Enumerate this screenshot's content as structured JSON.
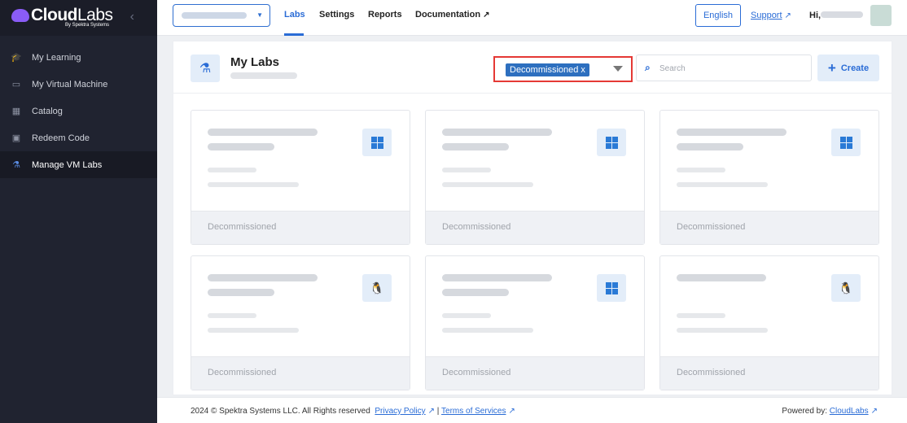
{
  "brand": {
    "name_bold": "Cloud",
    "name_light": "Labs",
    "tagline": "By Spektra Systems"
  },
  "sidebar": {
    "items": [
      {
        "label": "My Learning",
        "icon": "graduation-cap-icon",
        "active": false
      },
      {
        "label": "My Virtual Machine",
        "icon": "monitor-icon",
        "active": false
      },
      {
        "label": "Catalog",
        "icon": "grid-icon",
        "active": false
      },
      {
        "label": "Redeem Code",
        "icon": "ticket-icon",
        "active": false
      },
      {
        "label": "Manage VM Labs",
        "icon": "flask-icon",
        "active": true
      }
    ]
  },
  "topbar": {
    "tabs": [
      {
        "label": "Labs",
        "active": true
      },
      {
        "label": "Settings",
        "active": false
      },
      {
        "label": "Reports",
        "active": false
      },
      {
        "label": "Documentation",
        "active": false
      }
    ],
    "language": "English",
    "support": "Support",
    "greeting": "Hi,"
  },
  "page": {
    "title": "My Labs",
    "filter_chip": "Decommissioned x",
    "search_placeholder": "Search",
    "create_label": "Create"
  },
  "cards": [
    {
      "os": "windows",
      "status": "Decommissioned"
    },
    {
      "os": "windows",
      "status": "Decommissioned"
    },
    {
      "os": "windows",
      "status": "Decommissioned"
    },
    {
      "os": "linux",
      "status": "Decommissioned"
    },
    {
      "os": "windows",
      "status": "Decommissioned"
    },
    {
      "os": "linux",
      "status": "Decommissioned"
    }
  ],
  "footer": {
    "copyright": "2024 © Spektra Systems LLC. All Rights reserved",
    "privacy": "Privacy Policy",
    "separator": "|",
    "terms": "Terms of Services",
    "powered_by": "Powered by:",
    "powered_link": "CloudLabs"
  },
  "colors": {
    "accent": "#2a6cd6",
    "sidebar_bg": "#202330",
    "highlight_border": "#e53935",
    "chip_bg": "#2d6fbf"
  }
}
